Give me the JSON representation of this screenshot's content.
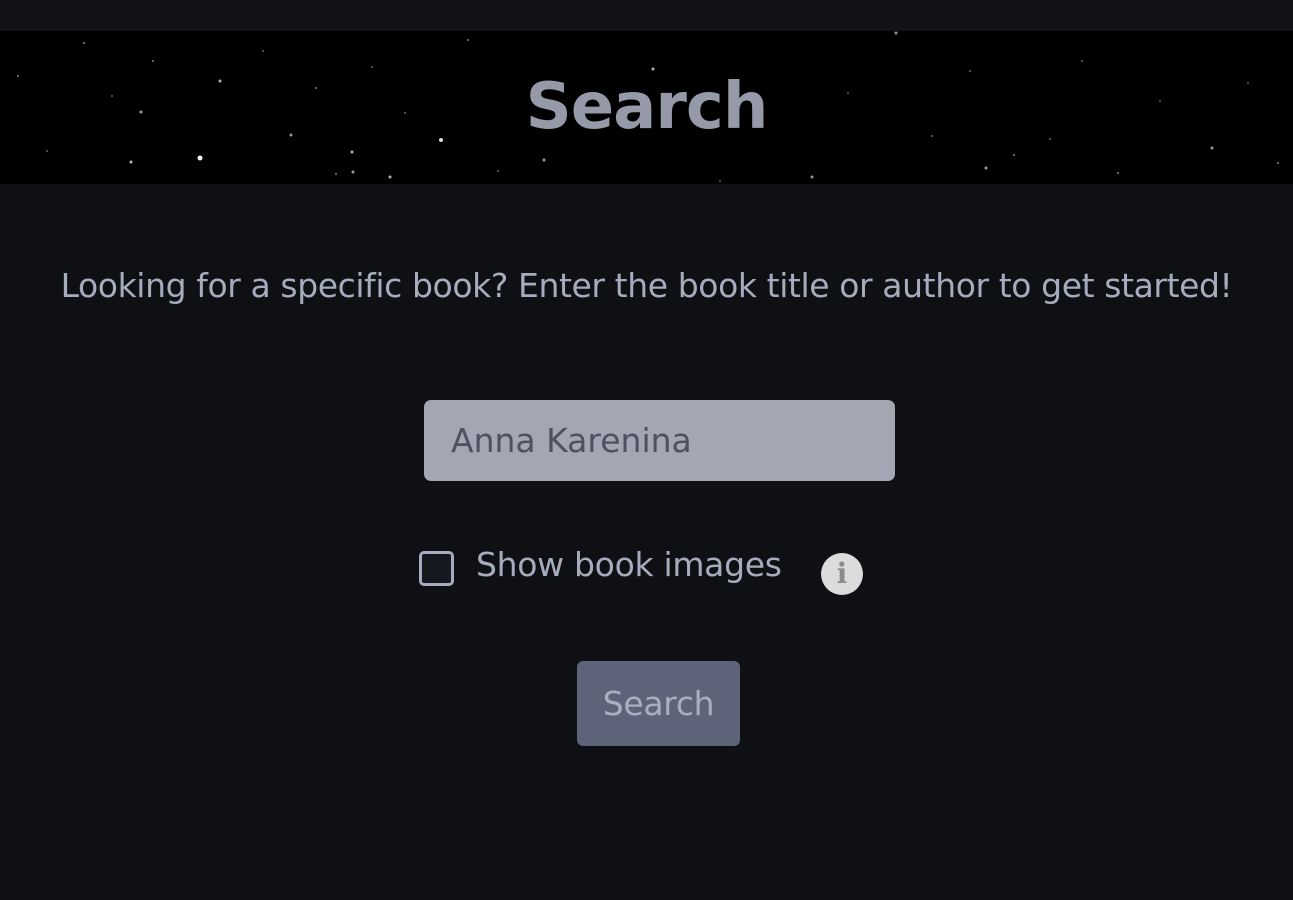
{
  "header": {
    "title": "Search"
  },
  "intro": {
    "text": "Looking for a specific book? Enter the book title or author to get started!"
  },
  "search": {
    "value": "Anna Karenina",
    "button_label": "Search"
  },
  "options": {
    "show_images_label": "Show book images",
    "show_images_checked": false,
    "info_icon": "info-icon"
  },
  "colors": {
    "page_background": "#0f1014",
    "header_background": "#000000",
    "title_text": "#9599a8",
    "body_text": "#a5acbd",
    "input_background": "#a3a7b4",
    "button_background": "#5d6479"
  }
}
